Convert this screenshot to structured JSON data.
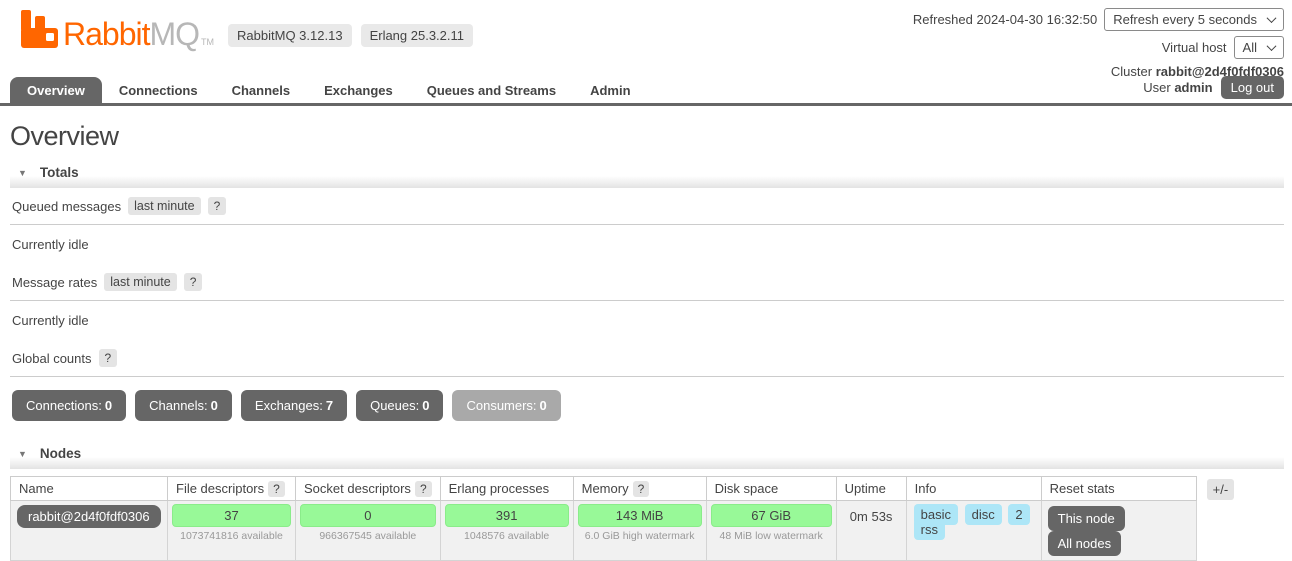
{
  "colors": {
    "accent_orange": "#ff6600",
    "bar_green": "#98f998",
    "tag_blue": "#ade6f7",
    "button_gray": "#666666",
    "disabled_gray": "#a9a9a9"
  },
  "header": {
    "brand": {
      "rabbit": "Rabbit",
      "mq": "MQ",
      "tm": "TM"
    },
    "version_badges": [
      "RabbitMQ 3.12.13",
      "Erlang 25.3.2.11"
    ],
    "refreshed": "Refreshed 2024-04-30 16:32:50",
    "refresh_interval": "Refresh every 5 seconds",
    "vhost_label": "Virtual host",
    "vhost_value": "All",
    "cluster_label": "Cluster",
    "cluster_value": "rabbit@2d4f0fdf0306",
    "user_label": "User",
    "user_value": "admin",
    "logout": "Log out"
  },
  "tabs": [
    {
      "label": "Overview",
      "active": true
    },
    {
      "label": "Connections",
      "active": false
    },
    {
      "label": "Channels",
      "active": false
    },
    {
      "label": "Exchanges",
      "active": false
    },
    {
      "label": "Queues and Streams",
      "active": false
    },
    {
      "label": "Admin",
      "active": false
    }
  ],
  "page_title": "Overview",
  "totals": {
    "title": "Totals",
    "queued_label": "Queued messages",
    "queued_badge": "last minute",
    "queued_help": "?",
    "queued_idle": "Currently idle",
    "rates_label": "Message rates",
    "rates_badge": "last minute",
    "rates_help": "?",
    "rates_idle": "Currently idle",
    "global_label": "Global counts",
    "global_help": "?",
    "counts": [
      {
        "label": "Connections:",
        "value": "0"
      },
      {
        "label": "Channels:",
        "value": "0"
      },
      {
        "label": "Exchanges:",
        "value": "7"
      },
      {
        "label": "Queues:",
        "value": "0"
      },
      {
        "label": "Consumers:",
        "value": "0"
      }
    ]
  },
  "nodes": {
    "title": "Nodes",
    "columns": [
      {
        "label": "Name",
        "help": ""
      },
      {
        "label": "File descriptors",
        "help": "?"
      },
      {
        "label": "Socket descriptors",
        "help": "?"
      },
      {
        "label": "Erlang processes",
        "help": ""
      },
      {
        "label": "Memory",
        "help": "?"
      },
      {
        "label": "Disk space",
        "help": ""
      },
      {
        "label": "Uptime",
        "help": ""
      },
      {
        "label": "Info",
        "help": ""
      },
      {
        "label": "Reset stats",
        "help": ""
      }
    ],
    "row": {
      "name": "rabbit@2d4f0fdf0306",
      "file_descriptors": {
        "value": "37",
        "sub": "1073741816 available"
      },
      "socket_descriptors": {
        "value": "0",
        "sub": "966367545 available"
      },
      "erlang_processes": {
        "value": "391",
        "sub": "1048576 available"
      },
      "memory": {
        "value": "143 MiB",
        "sub": "6.0 GiB high watermark"
      },
      "disk_space": {
        "value": "67 GiB",
        "sub": "48 MiB low watermark"
      },
      "uptime": "0m 53s",
      "info_tags": [
        "basic",
        "disc",
        "2",
        "rss"
      ],
      "reset_buttons": [
        "This node",
        "All nodes"
      ]
    },
    "toggle_columns": "+/-"
  }
}
